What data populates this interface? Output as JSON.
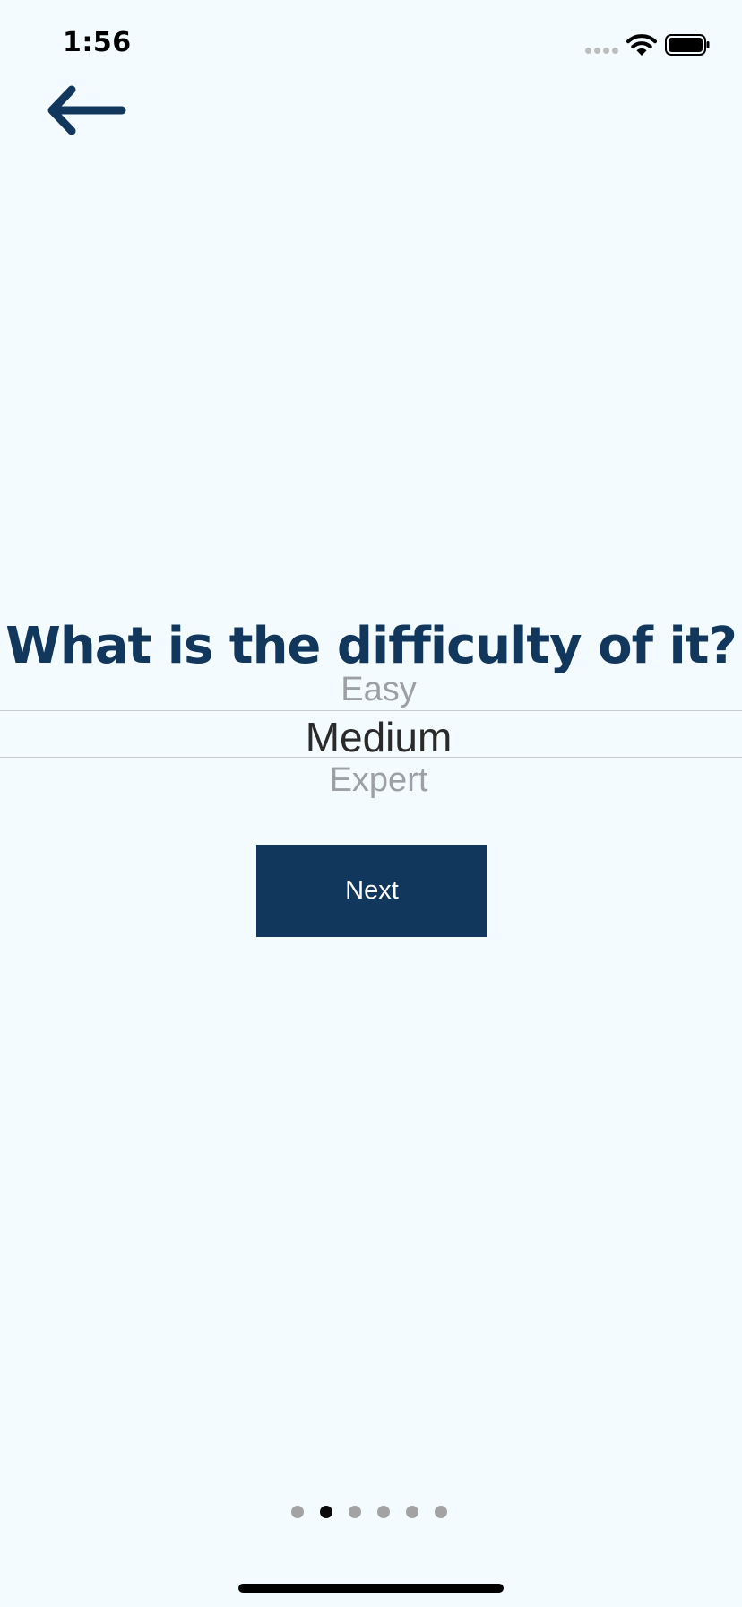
{
  "status_bar": {
    "time": "1:56"
  },
  "icons": {
    "back": "arrow-left-icon",
    "wifi": "wifi-icon",
    "battery": "battery-icon",
    "signal": "signal-dots-icon"
  },
  "colors": {
    "primary": "#11375d",
    "background": "#f4fbff",
    "dot_inactive": "#a3a3a3",
    "dot_active": "#0a0a0a"
  },
  "question": {
    "title": "What is the difficulty of it?"
  },
  "picker": {
    "options": [
      "Easy",
      "Medium",
      "Expert"
    ],
    "selected": "Medium"
  },
  "actions": {
    "next_label": "Next"
  },
  "pagination": {
    "total": 6,
    "current": 2
  }
}
